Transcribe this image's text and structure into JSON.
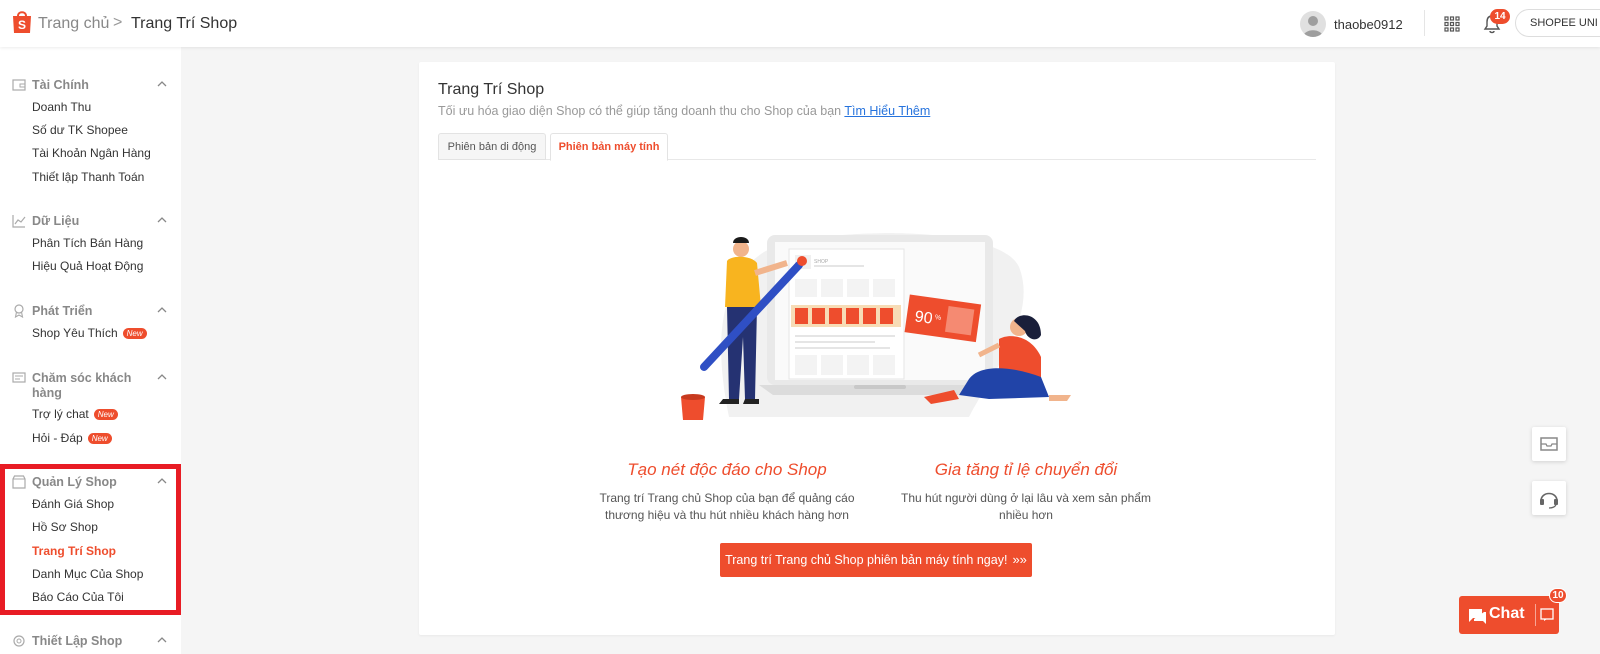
{
  "header": {
    "home": "Trang chủ",
    "separator": ">",
    "current": "Trang Trí Shop",
    "username": "thaobe0912",
    "notification_count": "14",
    "uni_button": "SHOPEE UNI",
    "brand_color": "#ee4d2d"
  },
  "sidebar": {
    "sections": [
      {
        "title": "Tài Chính",
        "icon": "wallet-icon",
        "items": [
          "Doanh Thu",
          "Số dư TK Shopee",
          "Tài Khoản Ngân Hàng",
          "Thiết lập Thanh Toán"
        ]
      },
      {
        "title": "Dữ Liệu",
        "icon": "chart-icon",
        "items": [
          "Phân Tích Bán Hàng",
          "Hiệu Quả Hoạt Động"
        ]
      },
      {
        "title": "Phát Triển",
        "icon": "badge-icon",
        "items": [
          "Shop Yêu Thích"
        ]
      },
      {
        "title": "Chăm sóc khách hàng",
        "icon": "chat-box-icon",
        "items": [
          "Trợ lý chat",
          "Hỏi - Đáp"
        ]
      },
      {
        "title": "Quản Lý Shop",
        "icon": "shop-icon",
        "items": [
          "Đánh Giá Shop",
          "Hồ Sơ Shop",
          "Trang Trí Shop",
          "Danh Mục Của Shop",
          "Báo Cáo Của Tôi"
        ]
      },
      {
        "title": "Thiết Lập Shop",
        "icon": "settings-icon",
        "items": []
      }
    ],
    "new_badge": "New",
    "active_item": "Trang Trí Shop"
  },
  "main": {
    "title": "Trang Trí Shop",
    "subtitle": "Tối ưu hóa giao diện Shop có thể giúp tăng doanh thu cho Shop của bạn",
    "learn_more": "Tìm Hiểu Thêm",
    "tabs": [
      "Phiên bản di động",
      "Phiên bản máy tính"
    ],
    "active_tab": "Phiên bản máy tính",
    "illustration_shop": "SHOP",
    "illustration_discount": "90",
    "illustration_percent": "%",
    "features": [
      {
        "title": "Tạo nét độc đáo cho Shop",
        "desc": "Trang trí Trang chủ Shop của bạn để quảng cáo thương hiệu và thu hút nhiều khách hàng hơn"
      },
      {
        "title": "Gia tăng tỉ lệ chuyển đổi",
        "desc": "Thu hút người dùng ở lại lâu và xem sản phẩm nhiều hơn"
      }
    ],
    "cta": "Trang trí Trang chủ Shop phiên bản máy tính ngay!",
    "cta_arrow": "»»"
  },
  "floating": {
    "chat_label": "Chat",
    "chat_count": "10"
  }
}
